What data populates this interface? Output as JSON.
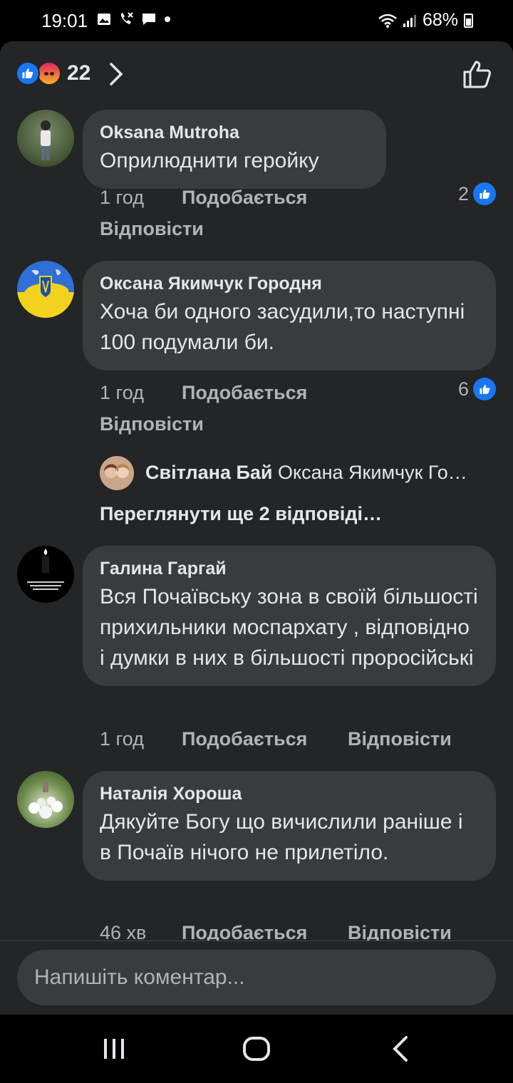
{
  "status_bar": {
    "time": "19:01",
    "battery": "68%",
    "icons": [
      "gallery-icon",
      "missed-call-icon",
      "message-icon",
      "dot-icon",
      "wifi-icon",
      "signal-icon",
      "battery-icon"
    ]
  },
  "header": {
    "reaction_count": "22",
    "reactions": [
      "like",
      "angry"
    ],
    "colors": {
      "like": "#1877f2",
      "angry": "#f7b125"
    }
  },
  "comments": [
    {
      "author": "Oksana Mutroha",
      "text": "Оприлюднити геройку",
      "time": "1 год",
      "like_label": "Подобається",
      "reply_label": "Відповісти",
      "likes": "2"
    },
    {
      "author": "Оксана Якимчук Городня",
      "text": "Хоча би одного засудили,то наступні 100 подумали би.",
      "time": "1 год",
      "like_label": "Подобається",
      "reply_label": "Відповісти",
      "likes": "6",
      "reply_preview": {
        "author": "Світлана Бай",
        "tag": "Оксана Якимчук Го…"
      },
      "more_replies": "Переглянути ще 2 відповіді…"
    },
    {
      "author": "Галина Гаргай",
      "text": "Вся Почаївську зона в своїй більшості прихильники моспархату , відповідно і думки в них в більшості проросійські",
      "time": "1 год",
      "like_label": "Подобається",
      "reply_label": "Відповісти"
    },
    {
      "author": "Наталія Хороша",
      "text": "Дякуйте Богу що вичислили раніше і в Почаїв нічого не прилетіло.",
      "time": "46 хв",
      "like_label": "Подобається",
      "reply_label": "Відповісти"
    }
  ],
  "composer": {
    "placeholder": "Напишіть коментар..."
  },
  "nav": {
    "buttons": [
      "recent-apps-icon",
      "home-icon",
      "back-icon"
    ]
  },
  "colors": {
    "background": "#242526",
    "bubble": "#3a3b3c",
    "text": "#e4e6eb",
    "secondary_text": "#b0b3b8",
    "accent": "#1877f2"
  }
}
